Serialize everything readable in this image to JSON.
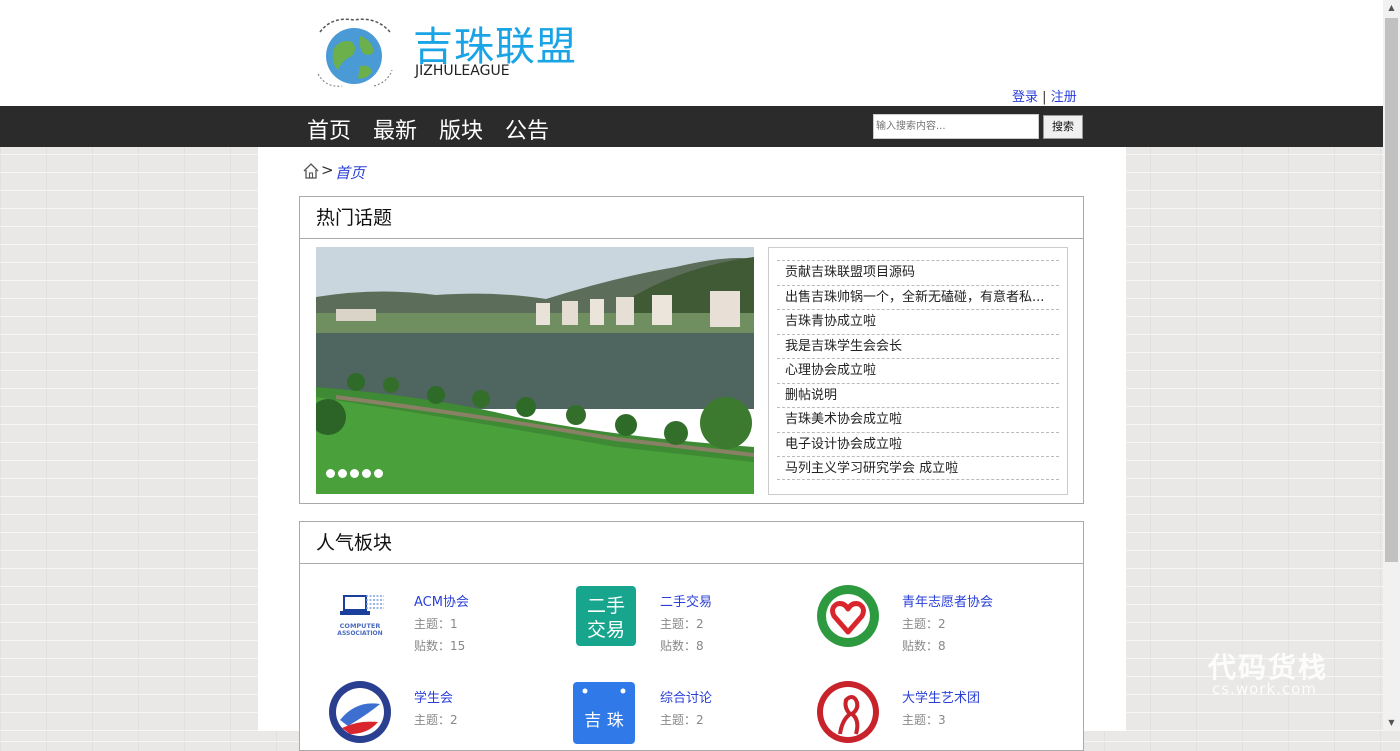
{
  "site": {
    "name": "吉珠联盟",
    "subtitle": "JIZHULEAGUE",
    "login": "登录",
    "divider": "|",
    "register": "注册"
  },
  "nav": {
    "items": [
      {
        "label": "首页"
      },
      {
        "label": "最新"
      },
      {
        "label": "版块"
      },
      {
        "label": "公告"
      }
    ]
  },
  "search": {
    "placeholder": "输入搜索内容...",
    "button": "搜索"
  },
  "breadcrumb": {
    "separator": ">",
    "current": "首页"
  },
  "hot": {
    "title": "热门话题",
    "topics": [
      "贡献吉珠联盟项目源码",
      "出售吉珠帅锅一个，全新无磕碰，有意者私...",
      "吉珠青协成立啦",
      "我是吉珠学生会会长",
      "心理协会成立啦",
      "删帖说明",
      "吉珠美术协会成立啦",
      "电子设计协会成立啦",
      "马列主义学习研究学会 成立啦"
    ],
    "slide_count": 5
  },
  "boards": {
    "title": "人气板块",
    "items": [
      {
        "name": "ACM协会",
        "topics": "主题：1",
        "posts": "贴数：15",
        "icon": "computer-association-icon"
      },
      {
        "name": "二手交易",
        "topics": "主题：2",
        "posts": "贴数：8",
        "icon": "second-hand-icon"
      },
      {
        "name": "青年志愿者协会",
        "topics": "主题：2",
        "posts": "贴数：8",
        "icon": "volunteer-heart-icon"
      },
      {
        "name": "学生会",
        "topics": "主题：2",
        "posts": "",
        "icon": "student-union-icon"
      },
      {
        "name": "综合讨论",
        "topics": "主题：2",
        "posts": "",
        "icon": "jizhu-discussion-icon"
      },
      {
        "name": "大学生艺术团",
        "topics": "主题：3",
        "posts": "",
        "icon": "art-troupe-icon"
      }
    ]
  },
  "icon_texts": {
    "second_hand_top": "二手",
    "second_hand_bottom": "交易",
    "discussion": "吉 珠",
    "computer_line1": "COMPUTER",
    "computer_line2": "ASSOCIATION"
  },
  "watermark": {
    "main": "代码货栈",
    "sub": "cs.work.com"
  },
  "colors": {
    "brand": "#1aa4e6",
    "nav_bg": "#2b2b2b",
    "link": "#2a3fd8",
    "teal_icon": "#18a58d",
    "blue_icon": "#2f7ae8"
  }
}
